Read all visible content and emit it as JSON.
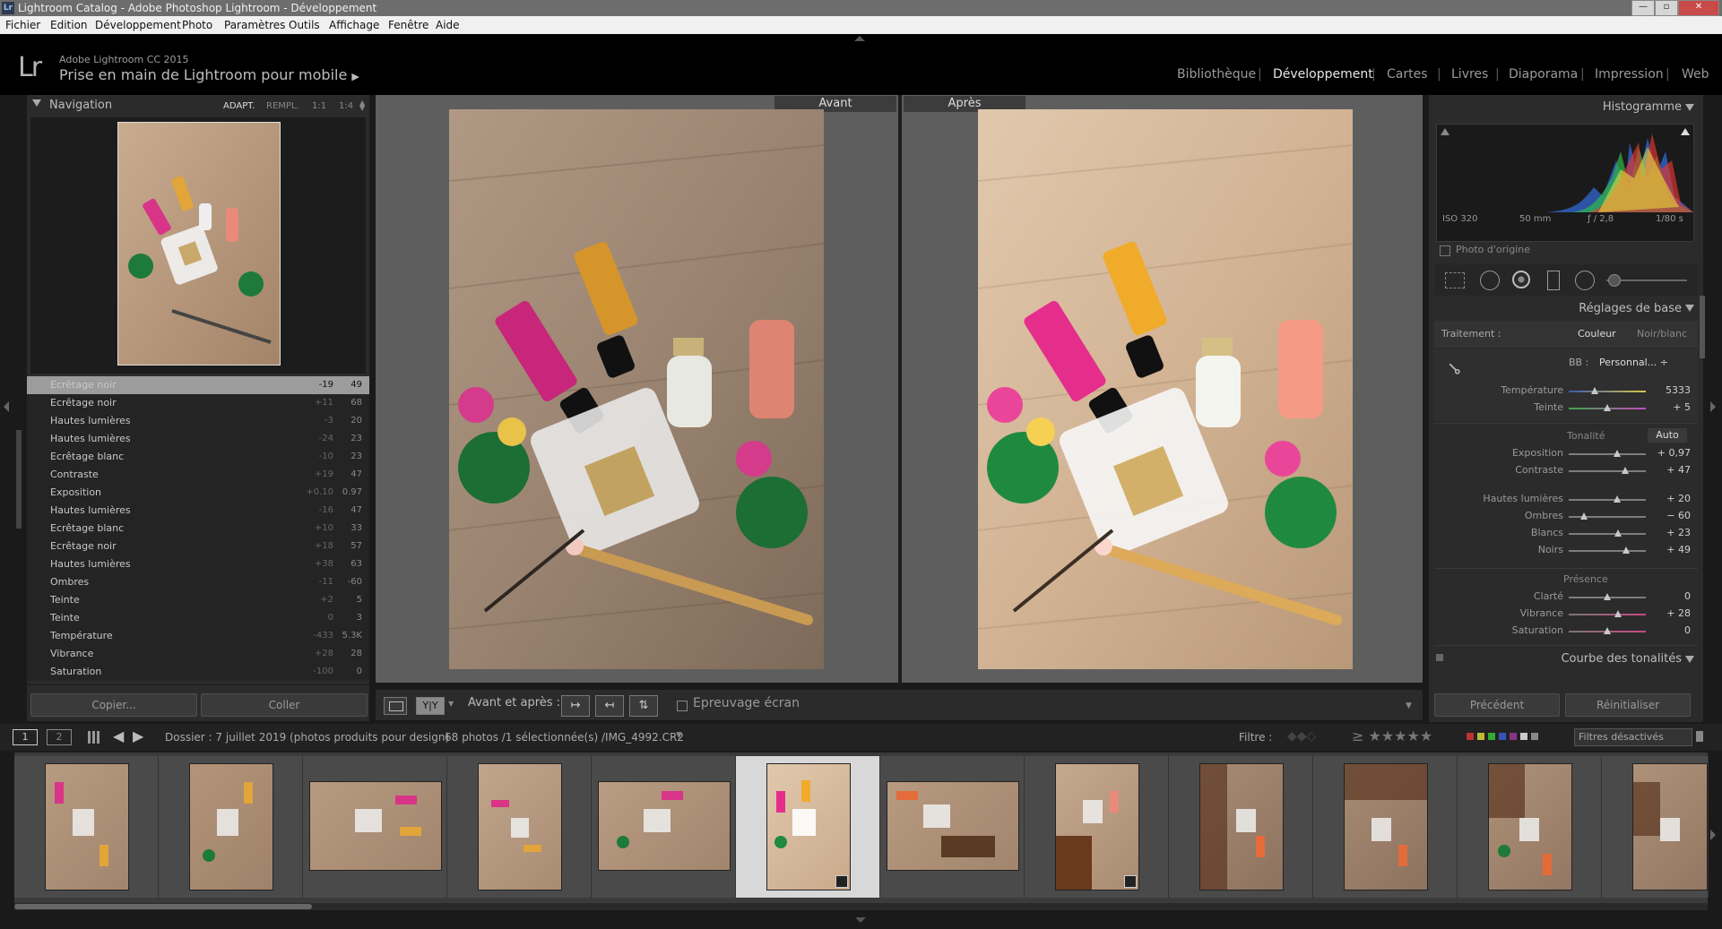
{
  "window": {
    "title": "Lightroom Catalog - Adobe Photoshop Lightroom - Développement",
    "app_badge": "Lr"
  },
  "menu": [
    "Fichier",
    "Edition",
    "Développement",
    "Photo",
    "Paramètres",
    "Outils",
    "Affichage",
    "Fenêtre",
    "Aide"
  ],
  "identity": {
    "logo": "Lr",
    "product": "Adobe Lightroom CC 2015",
    "catalog": "Prise en main de Lightroom pour mobile",
    "catalog_arrow": "▶"
  },
  "modules": [
    {
      "label": "Bibliothèque",
      "active": false
    },
    {
      "label": "Développement",
      "active": true
    },
    {
      "label": "Cartes",
      "active": false
    },
    {
      "label": "Livres",
      "active": false
    },
    {
      "label": "Diaporama",
      "active": false
    },
    {
      "label": "Impression",
      "active": false
    },
    {
      "label": "Web",
      "active": false
    }
  ],
  "navigator": {
    "title": "Navigation",
    "zoom_fit": "ADAPT.",
    "zoom_fill": "REMPL.",
    "zoom_1": "1:1",
    "zoom_2": "1:4"
  },
  "history": [
    {
      "label": "Ecrêtage noir",
      "a": "-19",
      "b": "49",
      "selected": true
    },
    {
      "label": "Ecrêtage noir",
      "a": "+11",
      "b": "68"
    },
    {
      "label": "Hautes lumières",
      "a": "-3",
      "b": "20"
    },
    {
      "label": "Hautes lumières",
      "a": "-24",
      "b": "23"
    },
    {
      "label": "Ecrêtage blanc",
      "a": "-10",
      "b": "23"
    },
    {
      "label": "Contraste",
      "a": "+19",
      "b": "47"
    },
    {
      "label": "Exposition",
      "a": "+0.10",
      "b": "0.97"
    },
    {
      "label": "Hautes lumières",
      "a": "-16",
      "b": "47"
    },
    {
      "label": "Ecrêtage blanc",
      "a": "+10",
      "b": "33"
    },
    {
      "label": "Ecrêtage noir",
      "a": "+18",
      "b": "57"
    },
    {
      "label": "Hautes lumières",
      "a": "+38",
      "b": "63"
    },
    {
      "label": "Ombres",
      "a": "-11",
      "b": "-60"
    },
    {
      "label": "Teinte",
      "a": "+2",
      "b": "5"
    },
    {
      "label": "Teinte",
      "a": "0",
      "b": "3"
    },
    {
      "label": "Température",
      "a": "-433",
      "b": "5.3K"
    },
    {
      "label": "Vibrance",
      "a": "+28",
      "b": "28"
    },
    {
      "label": "Saturation",
      "a": "-100",
      "b": "0"
    }
  ],
  "left_buttons": {
    "copy": "Copier...",
    "paste": "Coller"
  },
  "compare": {
    "before": "Avant",
    "after": "Après"
  },
  "toolbar": {
    "view_yy": "Y|Y",
    "before_after": "Avant et après :",
    "soft_proof": "Epreuvage écran"
  },
  "histogram": {
    "title": "Histogramme",
    "iso": "ISO 320",
    "focal": "50 mm",
    "aperture": "ƒ / 2,8",
    "shutter": "1/80 s",
    "original_photo": "Photo d'origine"
  },
  "basic": {
    "title": "Réglages de base",
    "treatment_label": "Traitement :",
    "treatment_color": "Couleur",
    "treatment_bw": "Noir/blanc",
    "wb_label": "BB :",
    "wb_value": "Personnal... ÷",
    "temp_label": "Température",
    "temp_value": "5333",
    "tint_label": "Teinte",
    "tint_value": "+ 5",
    "tone_label": "Tonalité",
    "tone_auto": "Auto",
    "exposure_label": "Exposition",
    "exposure_value": "+ 0,97",
    "contrast_label": "Contraste",
    "contrast_value": "+ 47",
    "highlights_label": "Hautes lumières",
    "highlights_value": "+ 20",
    "shadows_label": "Ombres",
    "shadows_value": "− 60",
    "whites_label": "Blancs",
    "whites_value": "+ 23",
    "blacks_label": "Noirs",
    "blacks_value": "+ 49",
    "presence_label": "Présence",
    "clarity_label": "Clarté",
    "clarity_value": "0",
    "vibrance_label": "Vibrance",
    "vibrance_value": "+ 28",
    "saturation_label": "Saturation",
    "saturation_value": "0"
  },
  "tone_curve": {
    "title": "Courbe des tonalités"
  },
  "right_buttons": {
    "previous": "Précédent",
    "reset": "Réinitialiser"
  },
  "filmbar": {
    "page1": "1",
    "page2": "2",
    "folder": "Dossier : 7 juillet 2019 (photos produits pour design)",
    "count": "68 photos /1 sélectionnée(s) /IMG_4992.CR2",
    "filter_label": "Filtre :",
    "filter_value": "Filtres désactivés"
  }
}
